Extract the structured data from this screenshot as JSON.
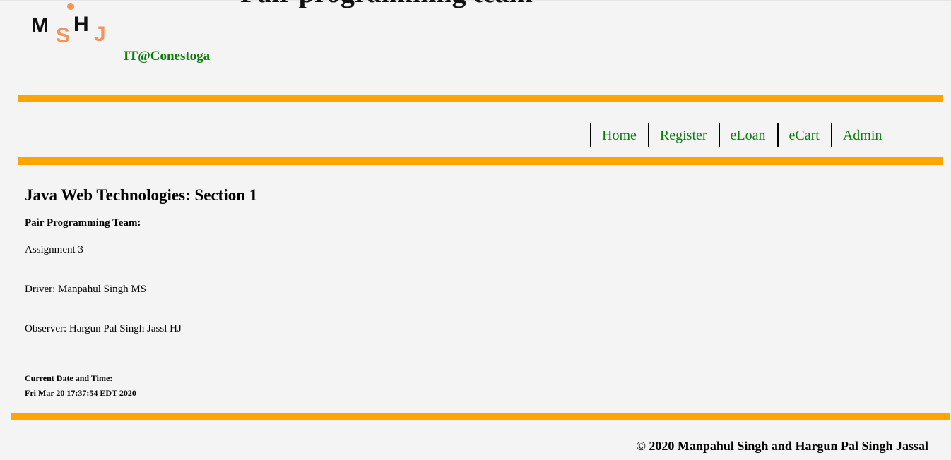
{
  "header": {
    "banner_partial": "Pair programming team",
    "subtitle": "IT@Conestoga",
    "logo": {
      "letters": [
        "M",
        "S",
        "H",
        "J"
      ]
    }
  },
  "nav": {
    "items": [
      {
        "label": "Home"
      },
      {
        "label": "Register"
      },
      {
        "label": "eLoan"
      },
      {
        "label": "eCart"
      },
      {
        "label": "Admin"
      }
    ]
  },
  "main": {
    "heading": "Java Web Technologies: Section 1",
    "team_label": "Pair Programming Team:",
    "assignment": "Assignment 3",
    "driver": "Driver: Manpahul Singh MS",
    "observer": "Observer: Hargun Pal Singh Jassl HJ",
    "datetime_label": "Current Date and Time:",
    "datetime_value": "Fri Mar 20 17:37:54 EDT 2020"
  },
  "footer": {
    "copyright": "© 2020 Manpahul Singh and Hargun Pal Singh Jassal"
  },
  "colors": {
    "accent": "#ffa500",
    "link": "#0a7d0a",
    "logo_orange": "#f4935b",
    "background": "#f4f4f4"
  }
}
